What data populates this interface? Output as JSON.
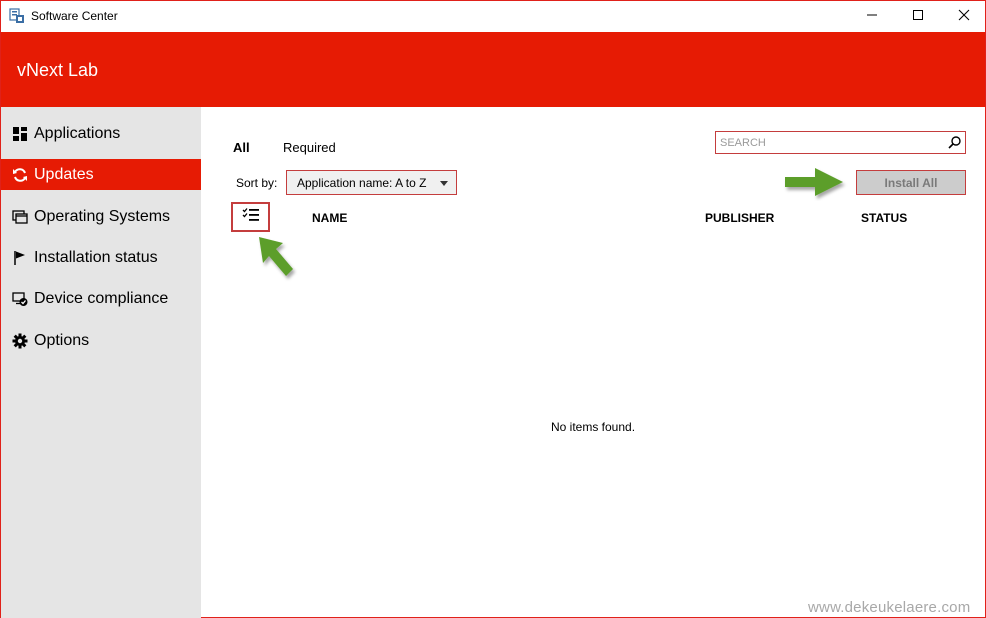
{
  "window": {
    "title": "Software Center",
    "icons": {
      "app": "software-center-icon",
      "minimize": "minimize-icon",
      "maximize": "maximize-icon",
      "close": "close-icon"
    }
  },
  "header": {
    "org_name": "vNext Lab"
  },
  "colors": {
    "accent": "#e61b04",
    "sidebar_bg": "#e5e5e5",
    "highlight_border": "#c43d3d",
    "arrow_green": "#5b9e2b"
  },
  "sidebar": {
    "items": [
      {
        "label": "Applications",
        "icon": "applications-grid-icon",
        "active": false
      },
      {
        "label": "Updates",
        "icon": "refresh-icon",
        "active": true
      },
      {
        "label": "Operating Systems",
        "icon": "operating-systems-icon",
        "active": false
      },
      {
        "label": "Installation status",
        "icon": "flag-icon",
        "active": false
      },
      {
        "label": "Device compliance",
        "icon": "device-compliance-icon",
        "active": false
      },
      {
        "label": "Options",
        "icon": "gear-icon",
        "active": false
      }
    ]
  },
  "main": {
    "tabs": [
      {
        "label": "All",
        "selected": true
      },
      {
        "label": "Required",
        "selected": false
      }
    ],
    "search": {
      "placeholder": "SEARCH",
      "icon": "search-icon"
    },
    "sort": {
      "label": "Sort by:",
      "value": "Application name: A to Z"
    },
    "install_all_label": "Install All",
    "select_all_icon": "checklist-icon",
    "columns": [
      "NAME",
      "PUBLISHER",
      "STATUS"
    ],
    "empty_message": "No items found."
  },
  "watermark": "www.dekeukelaere.com"
}
